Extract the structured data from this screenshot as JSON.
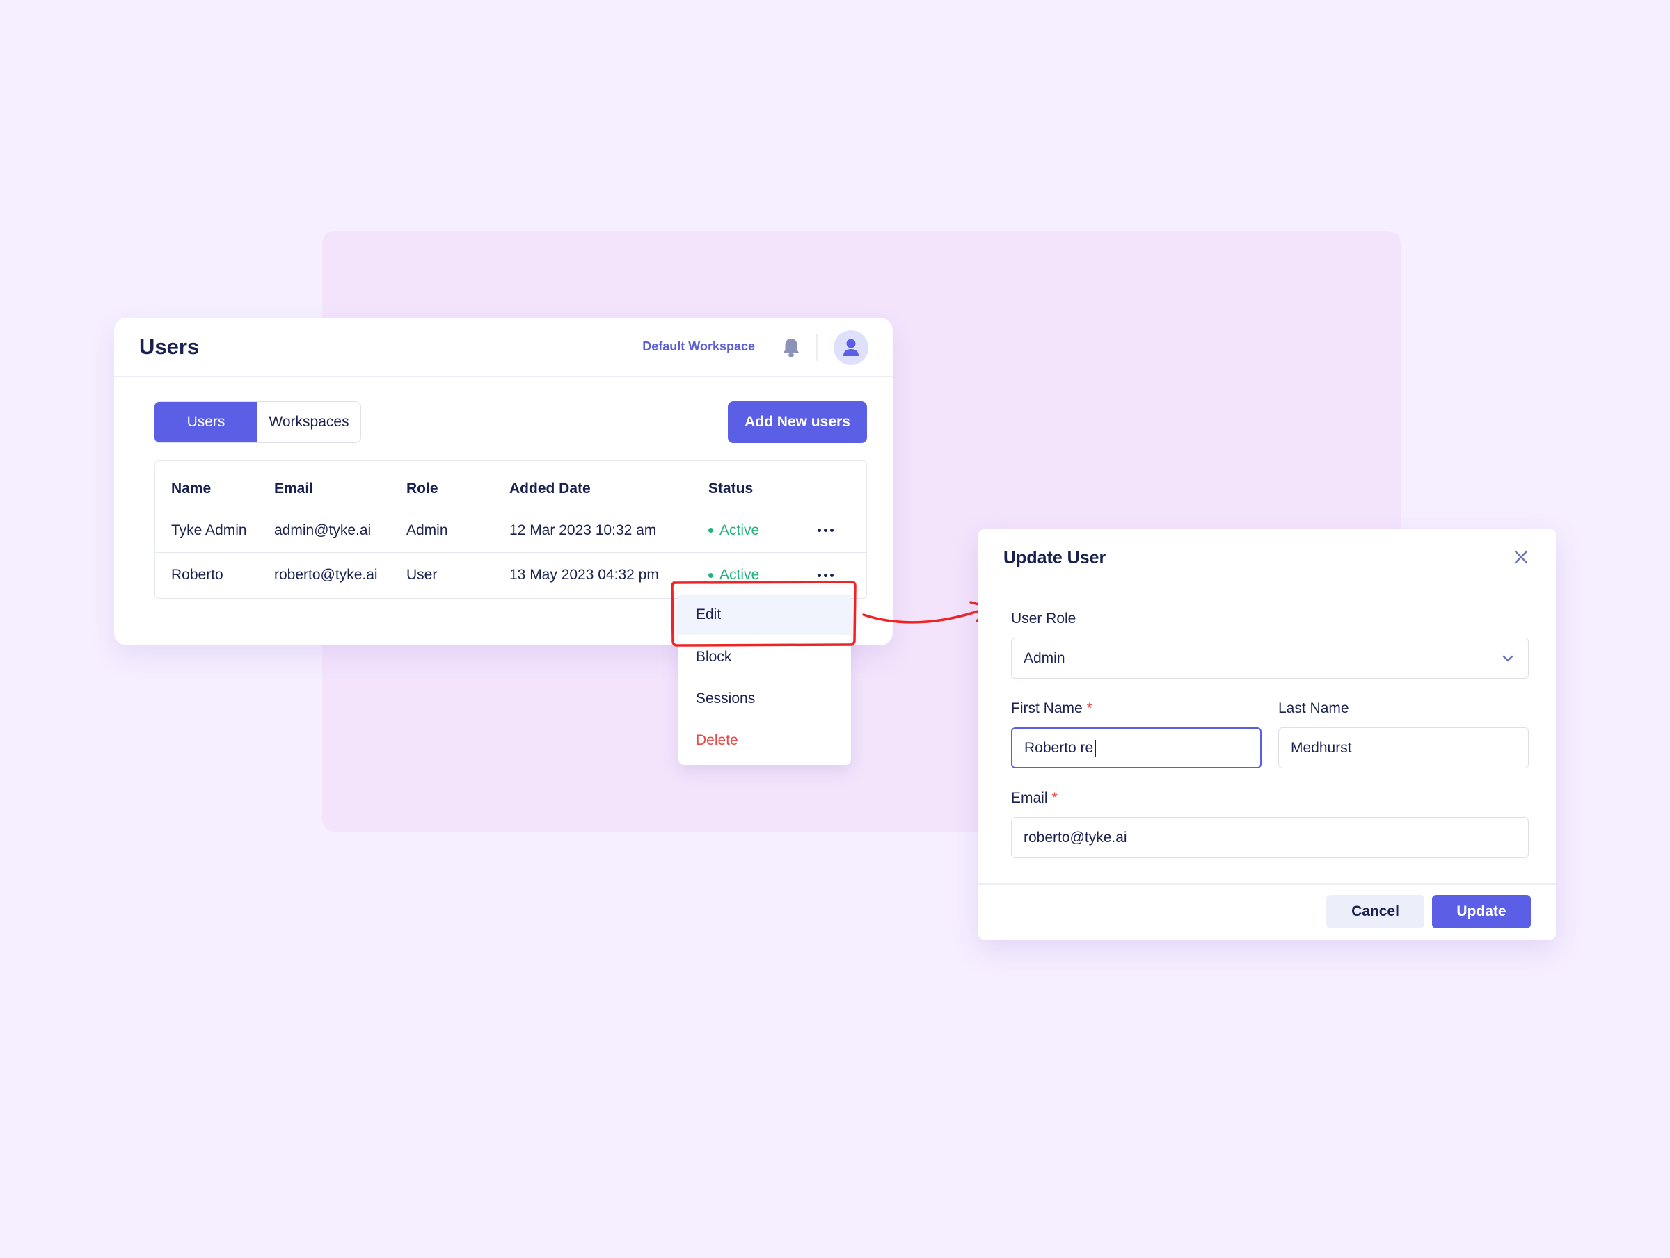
{
  "colors": {
    "accent": "#5a5fe6",
    "page_bg": "#f6efff",
    "active_status": "#1fb47a",
    "danger": "#ef4444",
    "annotation": "#ee2424"
  },
  "header": {
    "title": "Users",
    "workspace": "Default Workspace",
    "icons": [
      "bell-icon",
      "user-avatar-icon"
    ]
  },
  "tabs": [
    {
      "label": "Users",
      "active": true
    },
    {
      "label": "Workspaces",
      "active": false
    }
  ],
  "add_button": "Add New users",
  "table": {
    "columns": [
      "Name",
      "Email",
      "Role",
      "Added Date",
      "Status"
    ],
    "rows": [
      {
        "name": "Tyke Admin",
        "email": "admin@tyke.ai",
        "role": "Admin",
        "added": "12 Mar 2023 10:32 am",
        "status": "Active"
      },
      {
        "name": "Roberto",
        "email": "roberto@tyke.ai",
        "role": "User",
        "added": "13 May 2023 04:32 pm",
        "status": "Active"
      }
    ]
  },
  "menu": {
    "items": [
      "Edit",
      "Block",
      "Sessions",
      "Delete"
    ],
    "highlighted": "Edit"
  },
  "modal": {
    "title": "Update User",
    "user_role": {
      "label": "User Role",
      "value": "Admin"
    },
    "first_name": {
      "label": "First Name",
      "required": "*",
      "value": "Roberto re"
    },
    "last_name": {
      "label": "Last Name",
      "value": "Medhurst"
    },
    "email": {
      "label": "Email",
      "required": "*",
      "value": "roberto@tyke.ai"
    },
    "cancel": "Cancel",
    "update": "Update"
  }
}
